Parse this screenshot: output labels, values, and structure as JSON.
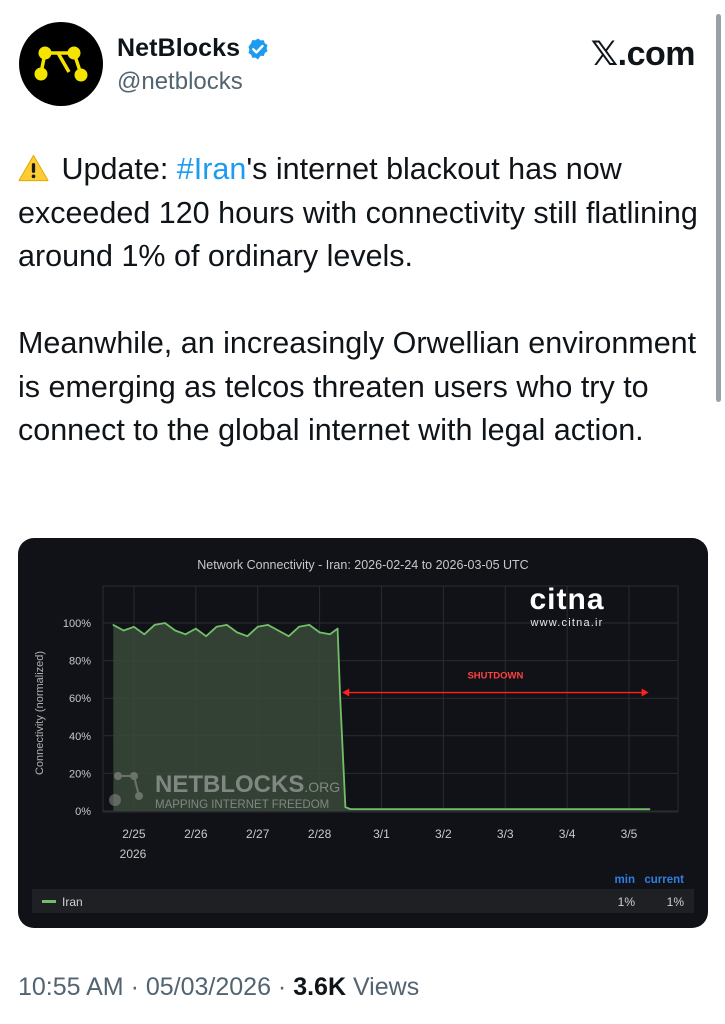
{
  "author": {
    "display_name": "NetBlocks",
    "handle": "@netblocks",
    "avatar_icon": "netblocks-logo-icon",
    "verified_icon": "verified-badge-icon"
  },
  "site": {
    "label": "𝕏.com"
  },
  "tweet": {
    "emoji": "warning-icon",
    "p1_prefix": " Update: ",
    "hashtag": "#Iran",
    "p1_rest": "'s internet blackout has now exceeded 120 hours with connectivity still flatlining around 1% of ordinary levels.",
    "p2": "Meanwhile, an increasingly Orwellian environment is emerging as telcos threaten users who try to connect to the global internet with legal action."
  },
  "chart": {
    "title": "Network Connectivity - Iran: 2026-02-24 to 2026-03-05 UTC",
    "ylabel": "Connectivity (normalized)",
    "y_ticks": [
      "0%",
      "20%",
      "40%",
      "60%",
      "80%",
      "100%"
    ],
    "x_ticks": [
      "2/25",
      "2/26",
      "2/27",
      "2/28",
      "3/1",
      "3/2",
      "3/3",
      "3/4",
      "3/5"
    ],
    "year_label": "2026",
    "annotation": "SHUTDOWN",
    "watermark_brand": "citna",
    "watermark_url": "www.citna.ir",
    "watermark_logo": "NETBLOCKS",
    "watermark_logo_suffix": ".ORG",
    "watermark_tagline": "MAPPING INTERNET FREEDOM",
    "legend": {
      "min_header": "min",
      "current_header": "current",
      "series_name": "Iran",
      "min_value": "1%",
      "current_value": "1%"
    },
    "colors": {
      "background": "#111217",
      "series": "#73bf69",
      "fill": "#3a4a3a",
      "annotation": "#ff2020",
      "legend_header": "#2f7fe0",
      "text": "#c8c8c8"
    }
  },
  "chart_data": {
    "type": "area",
    "title": "Network Connectivity - Iran: 2026-02-24 to 2026-03-05 UTC",
    "xlabel": "",
    "ylabel": "Connectivity (normalized)",
    "ylim": [
      0,
      100
    ],
    "x_ticks": [
      "2/25",
      "2/26",
      "2/27",
      "2/28",
      "3/1",
      "3/2",
      "3/3",
      "3/4",
      "3/5"
    ],
    "series": [
      {
        "name": "Iran",
        "x": [
          "2/24 16:00",
          "2/24 20:00",
          "2/25 00:00",
          "2/25 04:00",
          "2/25 08:00",
          "2/25 12:00",
          "2/25 16:00",
          "2/25 20:00",
          "2/26 00:00",
          "2/26 04:00",
          "2/26 08:00",
          "2/26 12:00",
          "2/26 16:00",
          "2/26 20:00",
          "2/27 00:00",
          "2/27 04:00",
          "2/27 08:00",
          "2/27 12:00",
          "2/27 16:00",
          "2/27 20:00",
          "2/28 00:00",
          "2/28 04:00",
          "2/28 07:00",
          "2/28 08:00",
          "2/28 10:00",
          "2/28 12:00",
          "3/1 00:00",
          "3/1 12:00",
          "3/2 00:00",
          "3/2 12:00",
          "3/3 00:00",
          "3/3 12:00",
          "3/4 00:00",
          "3/4 12:00",
          "3/5 00:00",
          "3/5 08:00"
        ],
        "values": [
          99,
          96,
          98,
          94,
          99,
          100,
          96,
          94,
          97,
          93,
          98,
          99,
          95,
          93,
          98,
          99,
          96,
          93,
          98,
          99,
          95,
          94,
          97,
          60,
          2,
          1,
          1,
          1,
          1,
          1,
          1,
          1,
          1,
          1,
          1,
          1
        ]
      }
    ],
    "annotations": [
      {
        "text": "SHUTDOWN",
        "from": "2/28 08:00",
        "to": "3/5 08:00",
        "y": 63
      }
    ],
    "legend": {
      "placement": "bottom-left",
      "columns": [
        "min",
        "current"
      ],
      "rows": [
        {
          "name": "Iran",
          "min": "1%",
          "current": "1%"
        }
      ]
    },
    "grid": true
  },
  "footer": {
    "time": "10:55 AM",
    "sep": " · ",
    "date": "05/03/2026",
    "views_count": "3.6K",
    "views_label": " Views"
  }
}
